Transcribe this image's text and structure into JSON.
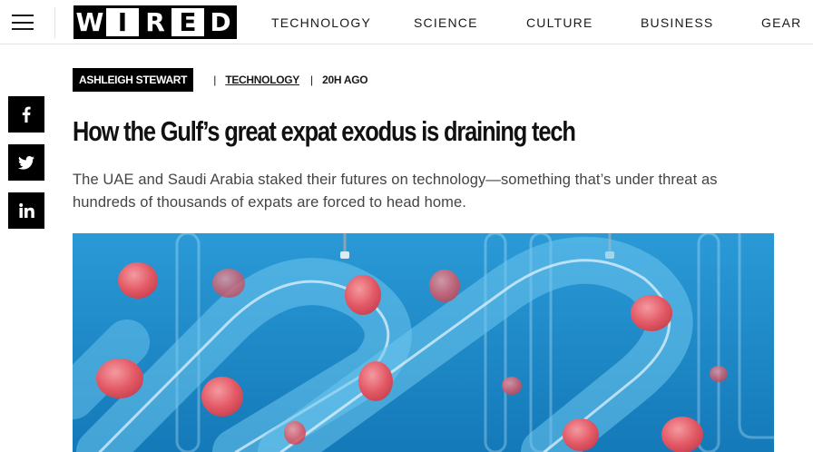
{
  "header": {
    "menu_icon": "hamburger-menu-icon",
    "logo_letters": [
      "W",
      "I",
      "R",
      "E",
      "D"
    ],
    "nav": [
      {
        "label": "TECHNOLOGY"
      },
      {
        "label": "SCIENCE"
      },
      {
        "label": "CULTURE"
      },
      {
        "label": "BUSINESS"
      },
      {
        "label": "GEAR"
      }
    ]
  },
  "share": {
    "facebook_icon": "facebook-icon",
    "twitter_icon": "twitter-icon",
    "linkedin_icon": "linkedin-icon"
  },
  "article": {
    "author": "ASHLEIGH STEWART",
    "separator": "|",
    "category": "TECHNOLOGY",
    "time_ago": "20H AGO",
    "headline": "How the Gulf’s great expat exodus is draining tech",
    "dek": "The UAE and Saudi Arabia staked their futures on technology—something that’s under threat as hundreds of thousands of expats are forced to head home."
  },
  "hero_image": {
    "subject": "glass tubes carrying brains on blue background",
    "colors": {
      "background": "#1a86c6",
      "brain": "#e8606a"
    }
  },
  "colors": {
    "text": "#1a1a1a",
    "dek_text": "#444444",
    "black": "#000000",
    "divider": "#e2e2e2"
  }
}
